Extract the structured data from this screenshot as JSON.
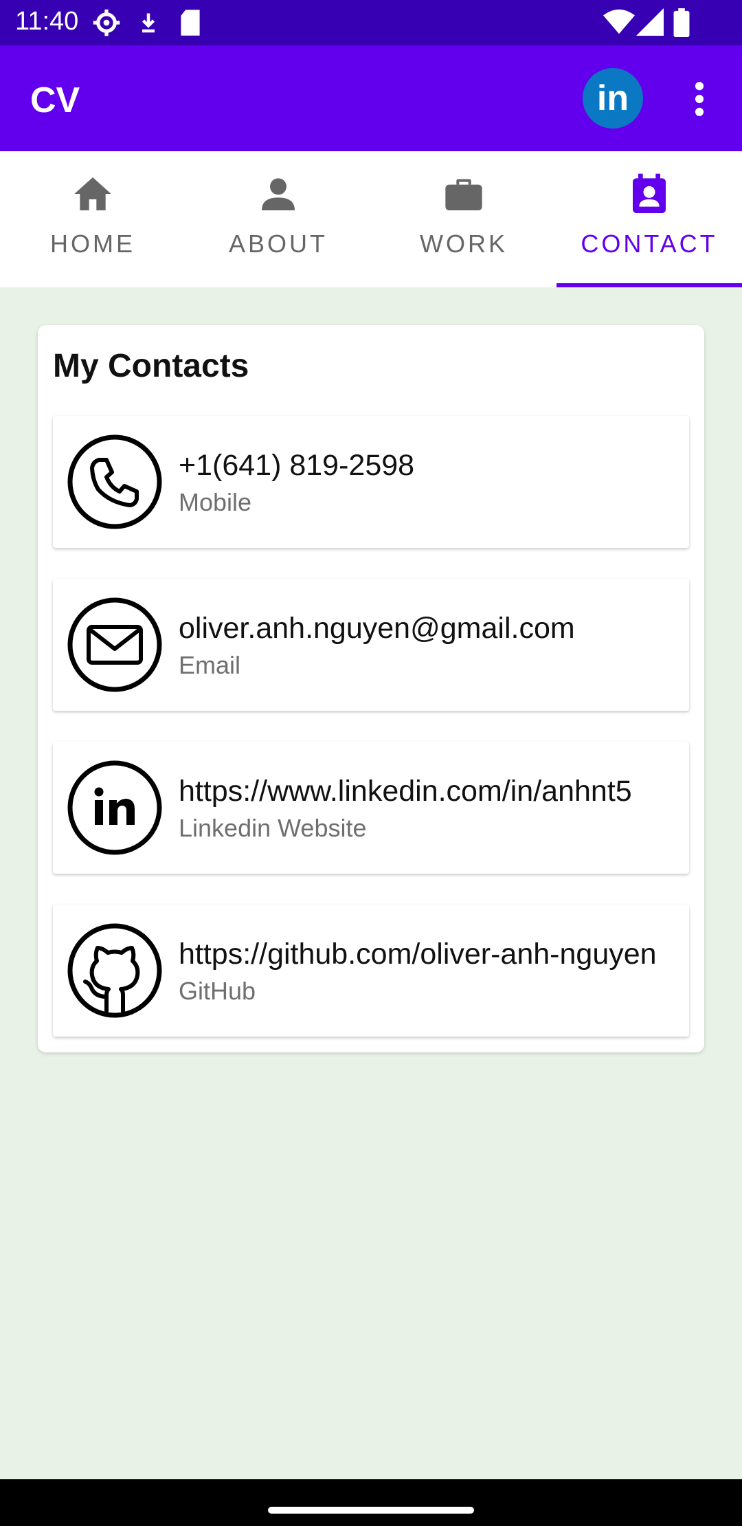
{
  "status_bar": {
    "time": "11:40",
    "icons": [
      "settings-icon",
      "download-icon",
      "sd-card-icon",
      "wifi-icon",
      "signal-icon",
      "battery-icon"
    ]
  },
  "app_bar": {
    "title": "CV",
    "linkedin_label": "in",
    "more_icon": "more-vert-icon"
  },
  "tabs": [
    {
      "label": "HOME",
      "icon": "home-icon",
      "active": false
    },
    {
      "label": "ABOUT",
      "icon": "person-icon",
      "active": false
    },
    {
      "label": "WORK",
      "icon": "briefcase-icon",
      "active": false
    },
    {
      "label": "CONTACT",
      "icon": "contact-icon",
      "active": true
    }
  ],
  "contacts": {
    "title": "My Contacts",
    "items": [
      {
        "value": "+1(641) 819-2598",
        "type": "Mobile",
        "icon": "phone-icon"
      },
      {
        "value": "oliver.anh.nguyen@gmail.com",
        "type": "Email",
        "icon": "email-icon"
      },
      {
        "value": "https://www.linkedin.com/in/anhnt5",
        "type": "Linkedin Website",
        "icon": "linkedin-icon"
      },
      {
        "value": "https://github.com/oliver-anh-nguyen",
        "type": "GitHub",
        "icon": "github-icon"
      }
    ]
  },
  "colors": {
    "primary": "#6200ee",
    "status_bar": "#3700b3",
    "background": "#e8f2e6",
    "linkedin": "#0a78c3"
  }
}
